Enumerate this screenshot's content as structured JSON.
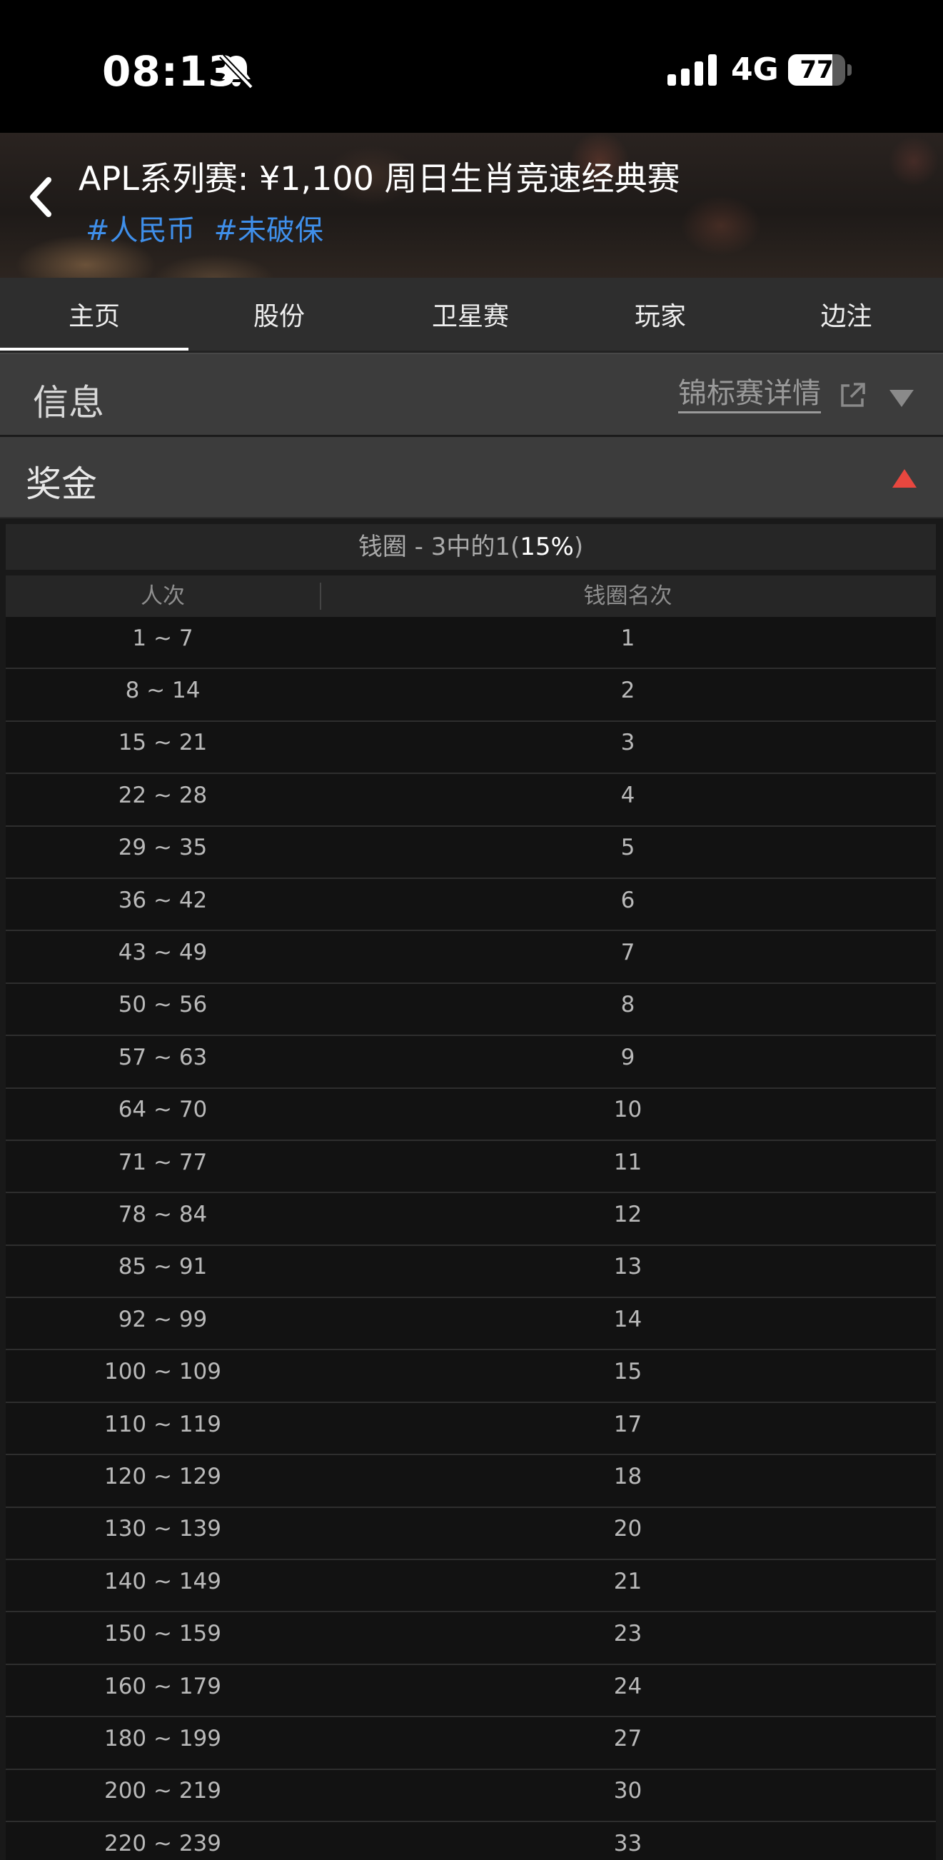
{
  "status_bar": {
    "time": "08:13",
    "network": "4G",
    "battery": "77",
    "battery_level": 0.77
  },
  "header": {
    "title": "APL系列赛: ¥1,100 周日生肖竞速经典赛",
    "tags": [
      "#人民币",
      "#未破保"
    ]
  },
  "tabs": [
    {
      "label": "主页",
      "active": true
    },
    {
      "label": "股份",
      "active": false
    },
    {
      "label": "卫星赛",
      "active": false
    },
    {
      "label": "玩家",
      "active": false
    },
    {
      "label": "边注",
      "active": false
    }
  ],
  "info": {
    "title": "信息",
    "details_link": "锦标赛详情"
  },
  "prize": {
    "title": "奖金",
    "caption_prefix": "钱圈 - 3中的1(",
    "caption_percent": "15%",
    "caption_suffix": ")",
    "columns": [
      "人次",
      "钱圈名次"
    ],
    "rows": [
      [
        "1 ~ 7",
        "1"
      ],
      [
        "8 ~ 14",
        "2"
      ],
      [
        "15 ~ 21",
        "3"
      ],
      [
        "22 ~ 28",
        "4"
      ],
      [
        "29 ~ 35",
        "5"
      ],
      [
        "36 ~ 42",
        "6"
      ],
      [
        "43 ~ 49",
        "7"
      ],
      [
        "50 ~ 56",
        "8"
      ],
      [
        "57 ~ 63",
        "9"
      ],
      [
        "64 ~ 70",
        "10"
      ],
      [
        "71 ~ 77",
        "11"
      ],
      [
        "78 ~ 84",
        "12"
      ],
      [
        "85 ~ 91",
        "13"
      ],
      [
        "92 ~ 99",
        "14"
      ],
      [
        "100 ~ 109",
        "15"
      ],
      [
        "110 ~ 119",
        "17"
      ],
      [
        "120 ~ 129",
        "18"
      ],
      [
        "130 ~ 139",
        "20"
      ],
      [
        "140 ~ 149",
        "21"
      ],
      [
        "150 ~ 159",
        "23"
      ],
      [
        "160 ~ 179",
        "24"
      ],
      [
        "180 ~ 199",
        "27"
      ],
      [
        "200 ~ 219",
        "30"
      ],
      [
        "220 ~ 239",
        "33"
      ]
    ]
  },
  "colors": {
    "accent_tag": "#3f8fea",
    "expand_triangle": "#e8473f"
  },
  "icons": {
    "back": "chevron-left-icon",
    "external": "external-link-icon",
    "collapse": "triangle-down-icon",
    "expand": "triangle-up-icon"
  }
}
